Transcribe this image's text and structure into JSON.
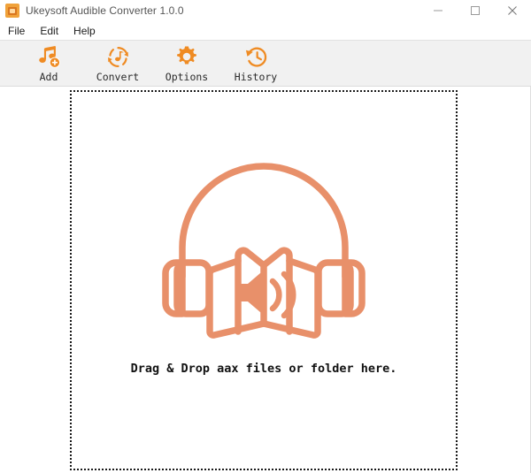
{
  "window": {
    "title": "Ukeysoft Audible Converter 1.0.0",
    "app_icon": "app-logo-icon",
    "controls": [
      {
        "name": "minimize-button",
        "glyph": "minimize-icon"
      },
      {
        "name": "maximize-button",
        "glyph": "maximize-icon"
      },
      {
        "name": "close-button",
        "glyph": "close-icon"
      }
    ]
  },
  "menu": {
    "items": [
      {
        "label": "File"
      },
      {
        "label": "Edit"
      },
      {
        "label": "Help"
      }
    ]
  },
  "toolbar": {
    "accent_color": "#ef8b23",
    "buttons": [
      {
        "label": "Add",
        "icon": "music-note-add-icon"
      },
      {
        "label": "Convert",
        "icon": "convert-refresh-note-icon"
      },
      {
        "label": "Options",
        "icon": "gear-icon"
      },
      {
        "label": "History",
        "icon": "clock-history-icon"
      }
    ]
  },
  "dropzone": {
    "illustration_icon": "audiobook-headphones-book-icon",
    "illustration_color": "#e8906a",
    "message": "Drag & Drop aax files or folder here.",
    "border_style": "dotted"
  }
}
